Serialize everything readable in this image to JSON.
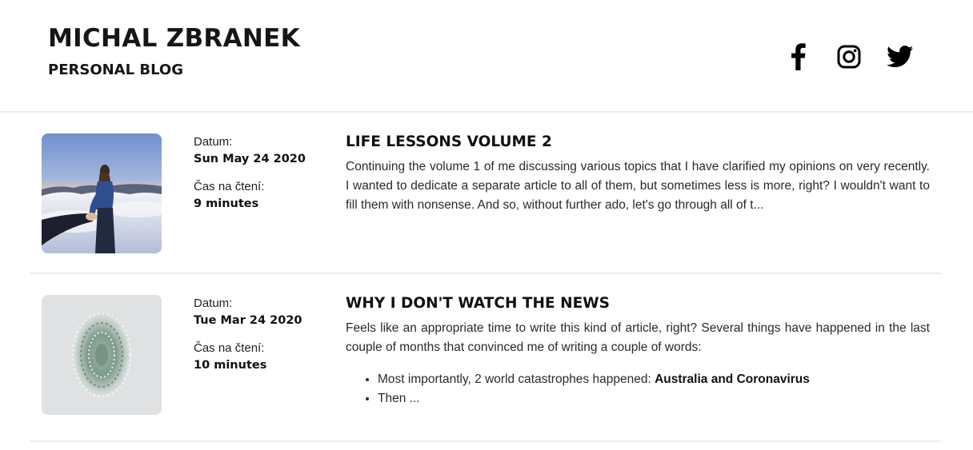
{
  "header": {
    "title": "MICHAL ZBRANEK",
    "subtitle": "PERSONAL BLOG",
    "social": [
      "facebook-icon",
      "instagram-icon",
      "twitter-icon"
    ]
  },
  "labels": {
    "date": "Datum:",
    "reading_time": "Čas na čtení:"
  },
  "posts": [
    {
      "title": "LIFE LESSONS VOLUME 2",
      "date": "Sun May 24 2020",
      "reading_time": "9 minutes",
      "excerpt": "Continuing the volume 1 of me discussing various topics that I have clarified my opinions on very recently. I wanted to dedicate a separate article to all of them, but sometimes less is more, right? I wouldn't want to fill them with nonsense. And so, without further ado, let's go through all of t..."
    },
    {
      "title": "WHY I DON'T WATCH THE NEWS",
      "date": "Tue Mar 24 2020",
      "reading_time": "10 minutes",
      "excerpt": "Feels like an appropriate time to write this kind of article, right? Several things have happened in the last couple of months that convinced me of writing a couple of words:",
      "bullets": [
        {
          "text": "Most importantly, 2 world catastrophes happened: ",
          "bold": "Australia and Coronavirus"
        },
        {
          "text": "Then ..."
        }
      ]
    }
  ]
}
